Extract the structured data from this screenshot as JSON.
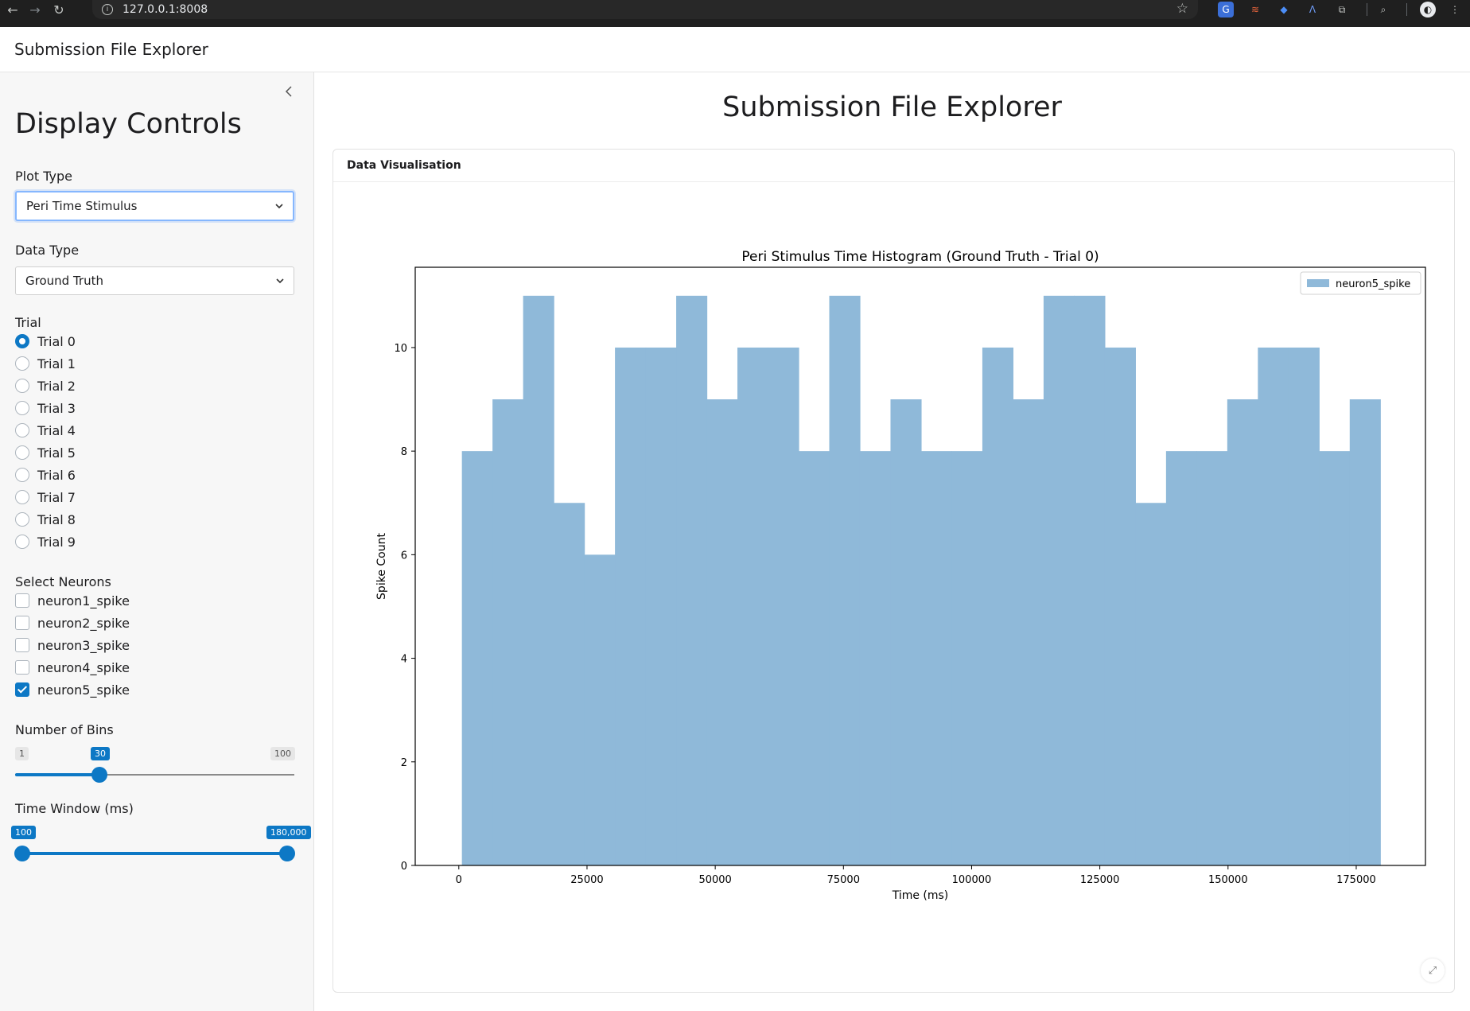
{
  "browser": {
    "url": "127.0.0.1:8008"
  },
  "app": {
    "header_title": "Submission File Explorer",
    "main_title": "Submission File Explorer"
  },
  "sidebar": {
    "heading": "Display Controls",
    "plot_type": {
      "label": "Plot Type",
      "value": "Peri Time Stimulus"
    },
    "data_type": {
      "label": "Data Type",
      "value": "Ground Truth"
    },
    "trial": {
      "label": "Trial",
      "options": [
        "Trial 0",
        "Trial 1",
        "Trial 2",
        "Trial 3",
        "Trial 4",
        "Trial 5",
        "Trial 6",
        "Trial 7",
        "Trial 8",
        "Trial 9"
      ],
      "selected_index": 0
    },
    "neurons": {
      "label": "Select Neurons",
      "options": [
        {
          "name": "neuron1_spike",
          "checked": false
        },
        {
          "name": "neuron2_spike",
          "checked": false
        },
        {
          "name": "neuron3_spike",
          "checked": false
        },
        {
          "name": "neuron4_spike",
          "checked": false
        },
        {
          "name": "neuron5_spike",
          "checked": true
        }
      ]
    },
    "bins": {
      "label": "Number of Bins",
      "min": "1",
      "max": "100",
      "value": "30",
      "value_fraction": 0.293
    },
    "time_window": {
      "label": "Time Window (ms)",
      "low": "100",
      "high": "180,000",
      "low_fraction": 0.0,
      "high_fraction": 1.0
    }
  },
  "card": {
    "header": "Data Visualisation"
  },
  "colors": {
    "accent": "#0d78c5",
    "bar": "#8fb9d9"
  },
  "chart_data": {
    "type": "bar",
    "title": "Peri Stimulus Time Histogram (Ground Truth - Trial 0)",
    "xlabel": "Time (ms)",
    "ylabel": "Spike Count",
    "legend": [
      "neuron5_spike"
    ],
    "legend_position": "top-right",
    "xlim": [
      -8500,
      188500
    ],
    "ylim": [
      0,
      11.55
    ],
    "xticks": [
      0,
      25000,
      50000,
      75000,
      100000,
      125000,
      150000,
      175000
    ],
    "yticks": [
      0,
      2,
      4,
      6,
      8,
      10
    ],
    "bin_start": 600,
    "bin_width": 5970,
    "series": [
      {
        "name": "neuron5_spike",
        "values": [
          8,
          9,
          11,
          7,
          6,
          10,
          10,
          11,
          9,
          10,
          10,
          8,
          11,
          8,
          9,
          8,
          8,
          10,
          9,
          11,
          11,
          10,
          7,
          8,
          8,
          9,
          10,
          10,
          8,
          9
        ]
      }
    ]
  }
}
